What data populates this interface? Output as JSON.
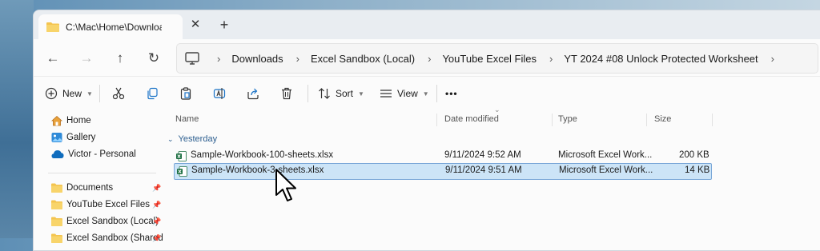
{
  "tab": {
    "title": "C:\\Mac\\Home\\Downloads\\Exc",
    "close": "✕",
    "new": "+"
  },
  "nav": {
    "back": "←",
    "forward": "→",
    "up": "↑",
    "refresh": "↻"
  },
  "breadcrumbs": [
    "Downloads",
    "Excel Sandbox (Local)",
    "YouTube Excel Files",
    "YT 2024 #08 Unlock Protected Worksheet"
  ],
  "toolbar": {
    "new_label": "New",
    "sort_label": "Sort",
    "view_label": "View",
    "more": "•••"
  },
  "sidebar": {
    "items": [
      {
        "label": "Home",
        "icon": "home-icon"
      },
      {
        "label": "Gallery",
        "icon": "gallery-icon"
      },
      {
        "label": "Victor - Personal",
        "icon": "cloud-icon"
      }
    ],
    "pinned": [
      {
        "label": "Documents"
      },
      {
        "label": "YouTube Excel Files"
      },
      {
        "label": "Excel Sandbox (Local)"
      },
      {
        "label": "Excel Sandbox (Shared"
      }
    ]
  },
  "columns": {
    "name": "Name",
    "date": "Date modified",
    "type": "Type",
    "size": "Size"
  },
  "group": {
    "label": "Yesterday"
  },
  "files": [
    {
      "name": "Sample-Workbook-100-sheets.xlsx",
      "date": "9/11/2024 9:52 AM",
      "type": "Microsoft Excel Work...",
      "size": "200 KB",
      "selected": false
    },
    {
      "name": "Sample-Workbook-3-sheets.xlsx",
      "date": "9/11/2024 9:51 AM",
      "type": "Microsoft Excel Work...",
      "size": "14 KB",
      "selected": true
    }
  ],
  "colors": {
    "accent": "#0067c0",
    "selection": "#cce4f7",
    "excel": "#1d6f42",
    "folder": "#f4c44e"
  }
}
